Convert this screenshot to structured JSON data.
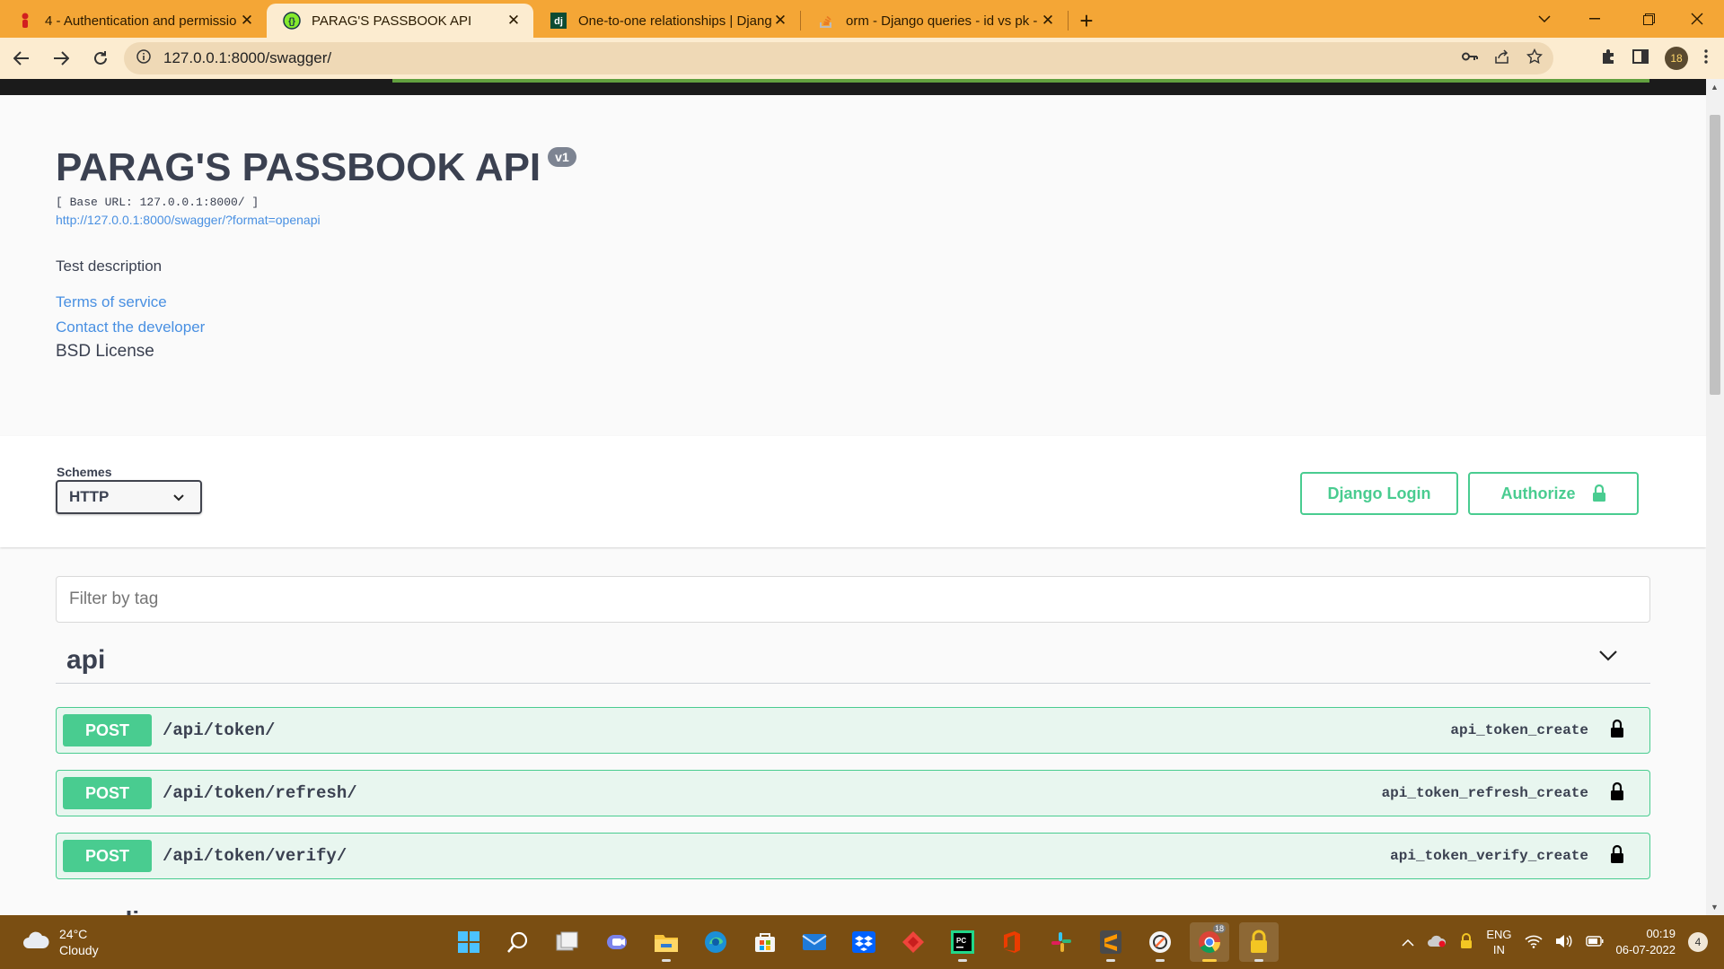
{
  "browser": {
    "tabs": [
      {
        "title": "4 - Authentication and permissio",
        "icon": "youtube-red-icon"
      },
      {
        "title": "PARAG'S PASSBOOK API",
        "icon": "swagger-icon",
        "active": true
      },
      {
        "title": "One-to-one relationships | Djang",
        "icon": "django-icon"
      },
      {
        "title": "orm - Django queries - id vs pk -",
        "icon": "stackoverflow-icon"
      }
    ],
    "url": "127.0.0.1:8000/swagger/",
    "profile_badge": "18"
  },
  "info": {
    "title": "PARAG'S PASSBOOK API",
    "version": "v1",
    "base_url": "[ Base URL: 127.0.0.1:8000/ ]",
    "spec_link": "http://127.0.0.1:8000/swagger/?format=openapi",
    "description": "Test description",
    "terms": "Terms of service",
    "contact": "Contact the developer",
    "license": "BSD License"
  },
  "schemes": {
    "label": "Schemes",
    "selected": "HTTP"
  },
  "buttons": {
    "django_login": "Django Login",
    "authorize": "Authorize"
  },
  "filter": {
    "placeholder": "Filter by tag"
  },
  "tag": {
    "name": "api",
    "operations": [
      {
        "method": "POST",
        "path": "/api/token/",
        "operation_id": "api_token_create"
      },
      {
        "method": "POST",
        "path": "/api/token/refresh/",
        "operation_id": "api_token_refresh_create"
      },
      {
        "method": "POST",
        "path": "/api/token/verify/",
        "operation_id": "api_token_verify_create"
      }
    ]
  },
  "next_tag_partial": "cli",
  "taskbar": {
    "weather_temp": "24°C",
    "weather_desc": "Cloudy",
    "lang_1": "ENG",
    "lang_2": "IN",
    "time": "00:19",
    "date": "06-07-2022",
    "notifications": "4",
    "chrome_badge": "18"
  },
  "colors": {
    "post_green": "#49cc90",
    "link_blue": "#4990e2",
    "browser_accent": "#f4a636",
    "taskbar": "#7a4e12"
  }
}
